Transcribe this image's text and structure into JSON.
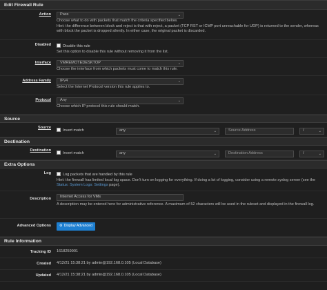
{
  "edit_rule": {
    "heading": "Edit Firewall Rule",
    "action": {
      "label": "Action",
      "value": "Pass",
      "help1": "Choose what to do with packets that match the criteria specified below.",
      "help2": "Hint: the difference between block and reject is that with reject, a packet (TCP RST or ICMP port unreachable for UDP) is returned to the sender, whereas with block the packet is dropped silently. In either case, the original packet is discarded."
    },
    "disabled": {
      "label": "Disabled",
      "checkbox": "Disable this rule",
      "help": "Set this option to disable this rule without removing it from the list."
    },
    "interface": {
      "label": "Interface",
      "value": "VMREMOTEDESKTOP",
      "help": "Choose the interface from which packets must come to match this rule."
    },
    "address_family": {
      "label": "Address Family",
      "value": "IPv4",
      "help": "Select the Internet Protocol version this rule applies to."
    },
    "protocol": {
      "label": "Protocol",
      "value": "Any",
      "help": "Choose which IP protocol this rule should match."
    }
  },
  "source": {
    "heading": "Source",
    "label": "Source",
    "invert": "Invert match",
    "type": "any",
    "address_placeholder": "Source Address",
    "slash": "/"
  },
  "destination": {
    "heading": "Destination",
    "label": "Destination",
    "invert": "Invert match",
    "type": "any",
    "address_placeholder": "Destination Address",
    "slash": "/"
  },
  "extra": {
    "heading": "Extra Options",
    "log": {
      "label": "Log",
      "checkbox": "Log packets that are handled by this rule",
      "hint_prefix": "Hint: the firewall has limited local log space. Don't turn on logging for everything. If doing a lot of logging, consider using a remote syslog server (see the ",
      "hint_link": "Status: System Logs: Settings",
      "hint_suffix": " page)."
    },
    "description": {
      "label": "Description",
      "value": "Internet Access for VMs",
      "help": "A description may be entered here for administrative reference. A maximum of 52 characters will be used in the ruleset and displayed in the firewall log."
    },
    "advanced": {
      "label": "Advanced Options",
      "button": "Display Advanced",
      "icon": "gear-icon"
    }
  },
  "rule_info": {
    "heading": "Rule Information",
    "tracking": {
      "label": "Tracking ID",
      "value": "1618259901"
    },
    "created": {
      "label": "Created",
      "value": "4/12/21 15:38:21 by admin@192.168.0.105 (Local Database)"
    },
    "updated": {
      "label": "Updated",
      "value": "4/12/21 15:38:21 by admin@192.168.0.105 (Local Database)"
    }
  },
  "colors": {
    "panel": "#2b2b2b",
    "background": "#1f1f1f",
    "accent": "#1e7fd0",
    "link": "#5b9bd5"
  }
}
